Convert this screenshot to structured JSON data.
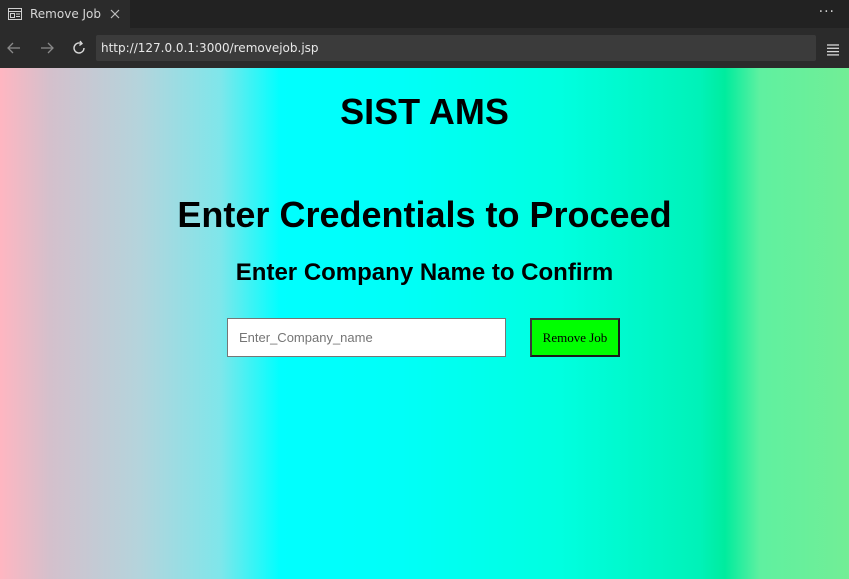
{
  "browser": {
    "tab": {
      "title": "Remove Job",
      "icon": "page-icon",
      "close_icon": "close-icon"
    },
    "menu_label": "···",
    "toolbar": {
      "back_icon": "arrow-left-icon",
      "forward_icon": "arrow-right-icon",
      "reload_icon": "reload-icon",
      "url": "http://127.0.0.1:3000/removejob.jsp",
      "menu_icon": "hamburger-icon"
    }
  },
  "page": {
    "site_title": "SIST AMS",
    "heading": "Enter Credentials to Proceed",
    "subheading": "Enter Company Name to Confirm",
    "company_input": {
      "value": "",
      "placeholder": "Enter_Company_name"
    },
    "remove_button_label": "Remove Job"
  },
  "colors": {
    "button_bg": "#00ff00",
    "gradient_left": "#ffb6c1",
    "gradient_mid": "#00ffff",
    "gradient_right": "#72ee96"
  }
}
